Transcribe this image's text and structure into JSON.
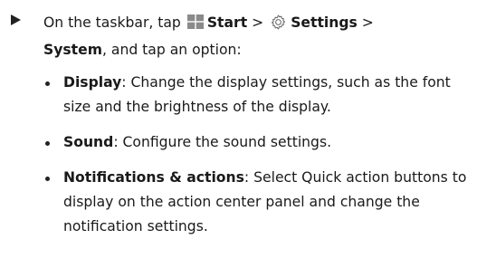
{
  "instruction": {
    "prefix": "On the taskbar, tap",
    "start_label": "Start",
    "separator": ">",
    "settings_label": "Settings",
    "system_label": "System",
    "suffix": ", and tap an option:"
  },
  "icons": {
    "arrow": "right-triangle-icon",
    "start": "windows-start-icon",
    "settings": "gear-icon"
  },
  "options": [
    {
      "term": "Display",
      "desc": ": Change the display settings, such as the font size and the brightness of the display."
    },
    {
      "term": "Sound",
      "desc": ": Configure the sound settings."
    },
    {
      "term": "Notifications & actions",
      "desc": ": Select Quick action buttons to display on the action center panel and change the notification settings."
    }
  ],
  "colors": {
    "text": "#1a1a1a",
    "start_icon": "#8a8a8a"
  }
}
